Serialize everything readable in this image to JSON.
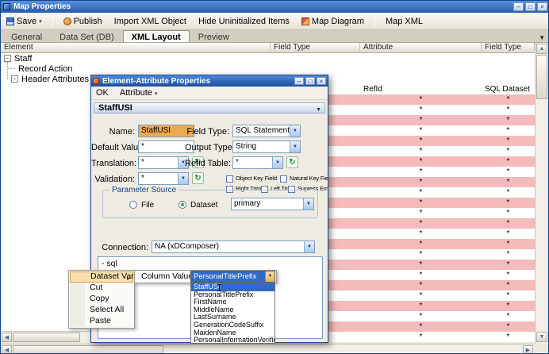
{
  "window": {
    "title": "Map Properties",
    "toolbar": {
      "save": "Save",
      "publish": "Publish",
      "import_xml": "Import XML Object",
      "hide_uninitialized": "Hide Uninitialized Items",
      "map_diagram": "Map Diagram",
      "map_xml": "Map XML"
    },
    "tabs": [
      {
        "label": "General",
        "active": false
      },
      {
        "label": "Data Set (DB)",
        "active": false
      },
      {
        "label": "XML Layout",
        "active": true
      },
      {
        "label": "Preview",
        "active": false
      }
    ],
    "grid": {
      "columns": [
        "Element",
        "Field Type",
        "Attribute",
        "Field Type"
      ],
      "tree": [
        "Staff",
        "Record Action",
        "Header Attributes"
      ],
      "ref_row": {
        "attribute": "RefId",
        "field_type": "SQL Dataset"
      },
      "star_rows": [
        {
          "a": "*",
          "f": "*"
        },
        {
          "a": "*",
          "f": "*"
        },
        {
          "a": "*",
          "f": "*"
        },
        {
          "a": "*",
          "f": "*"
        },
        {
          "a": "*",
          "f": "*"
        },
        {
          "a": "*",
          "f": "*"
        },
        {
          "a": "*",
          "f": "*"
        },
        {
          "a": "*",
          "f": "*"
        },
        {
          "a": "*",
          "f": "*"
        },
        {
          "a": "*",
          "f": "*"
        },
        {
          "a": "*",
          "f": "*"
        },
        {
          "a": "*",
          "f": "*"
        },
        {
          "a": "*",
          "f": "*"
        },
        {
          "a": "*",
          "f": "*"
        },
        {
          "a": "*",
          "f": "*"
        },
        {
          "a": "*",
          "f": "*"
        },
        {
          "a": "*",
          "f": "*"
        },
        {
          "a": "*",
          "f": "*"
        },
        {
          "a": "*",
          "f": "*"
        },
        {
          "a": "*",
          "f": "*"
        },
        {
          "a": "*",
          "f": "*"
        },
        {
          "a": "*",
          "f": "*"
        },
        {
          "a": "*",
          "f": "*"
        },
        {
          "a": "*",
          "f": "*"
        }
      ]
    }
  },
  "dialog": {
    "title": "Element-Attribute Properties",
    "menu": {
      "ok": "OK",
      "attribute": "Attribute"
    },
    "section_tab": "StaffUSI",
    "fields": {
      "name_label": "Name:",
      "name_value": "StaffUSI",
      "field_type_label": "Field Type:",
      "field_type_value": "SQL Statement",
      "default_value_label": "Default Value:",
      "default_value": "*",
      "output_type_label": "Output Type:",
      "output_type_value": "String",
      "translation_label": "Translation:",
      "translation_value": "*",
      "refid_table_label": "Refid Table:",
      "refid_table_value": "*",
      "validation_label": "Validation:",
      "validation_value": "*"
    },
    "checkboxes": [
      "Object Key Field",
      "Natural Key Field",
      "Right Trim",
      "Left Trim",
      "Supress Empty"
    ],
    "parameter_source": {
      "legend": "Parameter Source",
      "file_label": "File",
      "dataset_label": "Dataset",
      "dataset_value": "primary"
    },
    "connection_label": "Connection:",
    "connection_value": "NA (xDComposer)",
    "sql_header": "- sql"
  },
  "context_menu": {
    "items": [
      "Dataset Variable",
      "Cut",
      "Copy",
      "Select All",
      "Paste"
    ],
    "submenu_label": "Column Value",
    "combo_value": "PersonalTitlePrefix",
    "options": [
      "StaffUSI",
      "PersonalTitlePrefix",
      "FirstName",
      "MiddleName",
      "LastSurname",
      "GenerationCodeSuffix",
      "MaidenName",
      "PersonalInformationVerificationType"
    ]
  }
}
